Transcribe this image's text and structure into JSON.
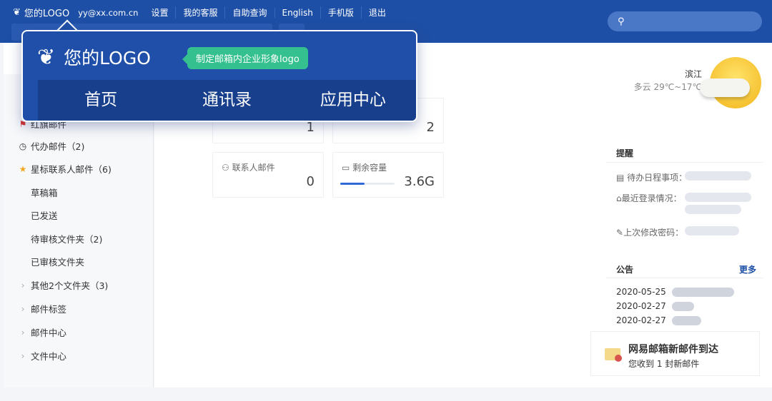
{
  "header": {
    "logo": "您的LOGO",
    "email": "yy@xx.com.cn",
    "links": [
      "设置",
      "我的客服",
      "自助查询",
      "English",
      "手机版",
      "退出"
    ]
  },
  "search": {
    "placeholder": ""
  },
  "popup": {
    "logo": "您的LOGO",
    "tip": "制定邮箱内企业形象logo",
    "nav": [
      "首页",
      "通讯录",
      "应用中心"
    ]
  },
  "sidebar": {
    "items": [
      {
        "label": "红旗邮件",
        "icon": "flag"
      },
      {
        "label": "代办邮件（2)",
        "icon": "clock"
      },
      {
        "label": "星标联系人邮件（6)",
        "icon": "star"
      },
      {
        "label": "草稿箱",
        "icon": ""
      },
      {
        "label": "已发送",
        "icon": ""
      },
      {
        "label": "待审核文件夹（2)",
        "icon": ""
      },
      {
        "label": "已审核文件夹",
        "icon": ""
      },
      {
        "label": "其他2个文件夹（3)",
        "icon": "chevron"
      },
      {
        "label": "邮件标签",
        "icon": "chevron"
      },
      {
        "label": "邮件中心",
        "icon": "chevron"
      },
      {
        "label": "文件中心",
        "icon": "chevron"
      }
    ]
  },
  "cards": {
    "c1": {
      "value": "1"
    },
    "c2": {
      "value": "2"
    },
    "contacts": {
      "label": "联系人邮件",
      "value": "0"
    },
    "storage": {
      "label": "剩余容量",
      "value": "3.6G",
      "fill_percent": 45
    }
  },
  "weather": {
    "city": "滨江",
    "desc": "多云 29℃~17℃"
  },
  "reminders": {
    "title": "提醒",
    "items": [
      "待办日程事项：",
      "最近登录情况：",
      "上次修改密码："
    ]
  },
  "announcements": {
    "title": "公告",
    "more": "更多",
    "dates": [
      "2020-05-25",
      "2020-02-27",
      "2020-02-27"
    ]
  },
  "notification": {
    "title": "网易邮箱新邮件到达",
    "body": "您收到 1 封新邮件"
  },
  "colors": {
    "brand": "#1e4fa6",
    "tip": "#35c08f",
    "accent": "#2f6ad8"
  }
}
